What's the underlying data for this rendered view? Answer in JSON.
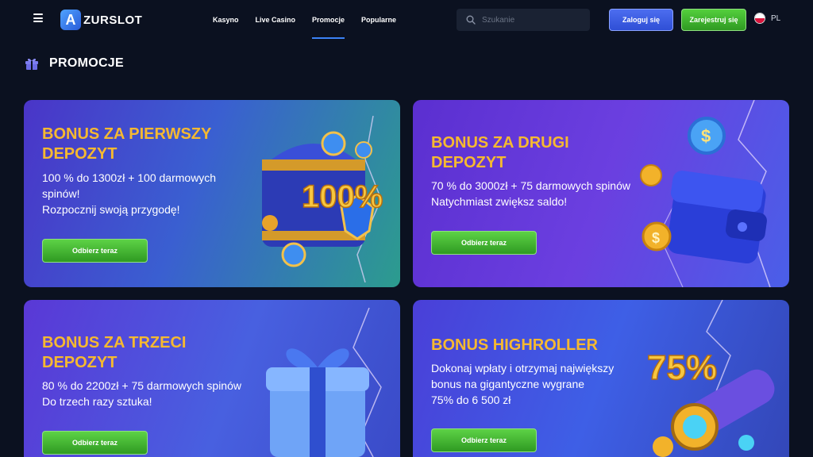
{
  "header": {
    "logo_letter": "A",
    "logo_text": "ZURSLOT",
    "nav": [
      "Kasyno",
      "Live Casino",
      "Promocje",
      "Popularne"
    ],
    "active_nav": "Promocje",
    "search_placeholder": "Szukanie",
    "login_label": "Zaloguj się",
    "register_label": "Zarejestruj się",
    "language": "PL"
  },
  "page": {
    "title": "PROMOCJE"
  },
  "promotions": [
    {
      "title_line1": "BONUS ZA PIERWSZY",
      "title_line2": "DEPOZYT",
      "desc_line1": "100 % do 1300zł + 100 darmowych",
      "desc_line2": "spinów!",
      "desc_line3": "Rozpocznij swoją przygodę!",
      "button": "Odbierz teraz",
      "art_text": "100%"
    },
    {
      "title_line1": "BONUS ZA DRUGI",
      "title_line2": "DEPOZYT",
      "desc_line1": "70 % do 3000zł + 75 darmowych spinów",
      "desc_line2": "Natychmiast zwiększ saldo!",
      "button": "Odbierz teraz"
    },
    {
      "title_line1": "BONUS ZA TRZECI",
      "title_line2": "DEPOZYT",
      "desc_line1": "80 % do 2200zł + 75 darmowych spinów",
      "desc_line2": "Do trzech razy sztuka!",
      "button": "Odbierz teraz"
    },
    {
      "title_line1": "BONUS HIGHROLLER",
      "desc_line1": "Dokonaj wpłaty i otrzymaj największy",
      "desc_line2": "bonus na gigantyczne wygrane",
      "desc_line3": "75% do 6 500 zł",
      "button": "Odbierz teraz",
      "art_text": "75%"
    }
  ],
  "colors": {
    "background": "#0b1120",
    "title_gold": "#f6b930",
    "accent_blue": "#3b82f6",
    "cta_green": "#4cbf36"
  }
}
